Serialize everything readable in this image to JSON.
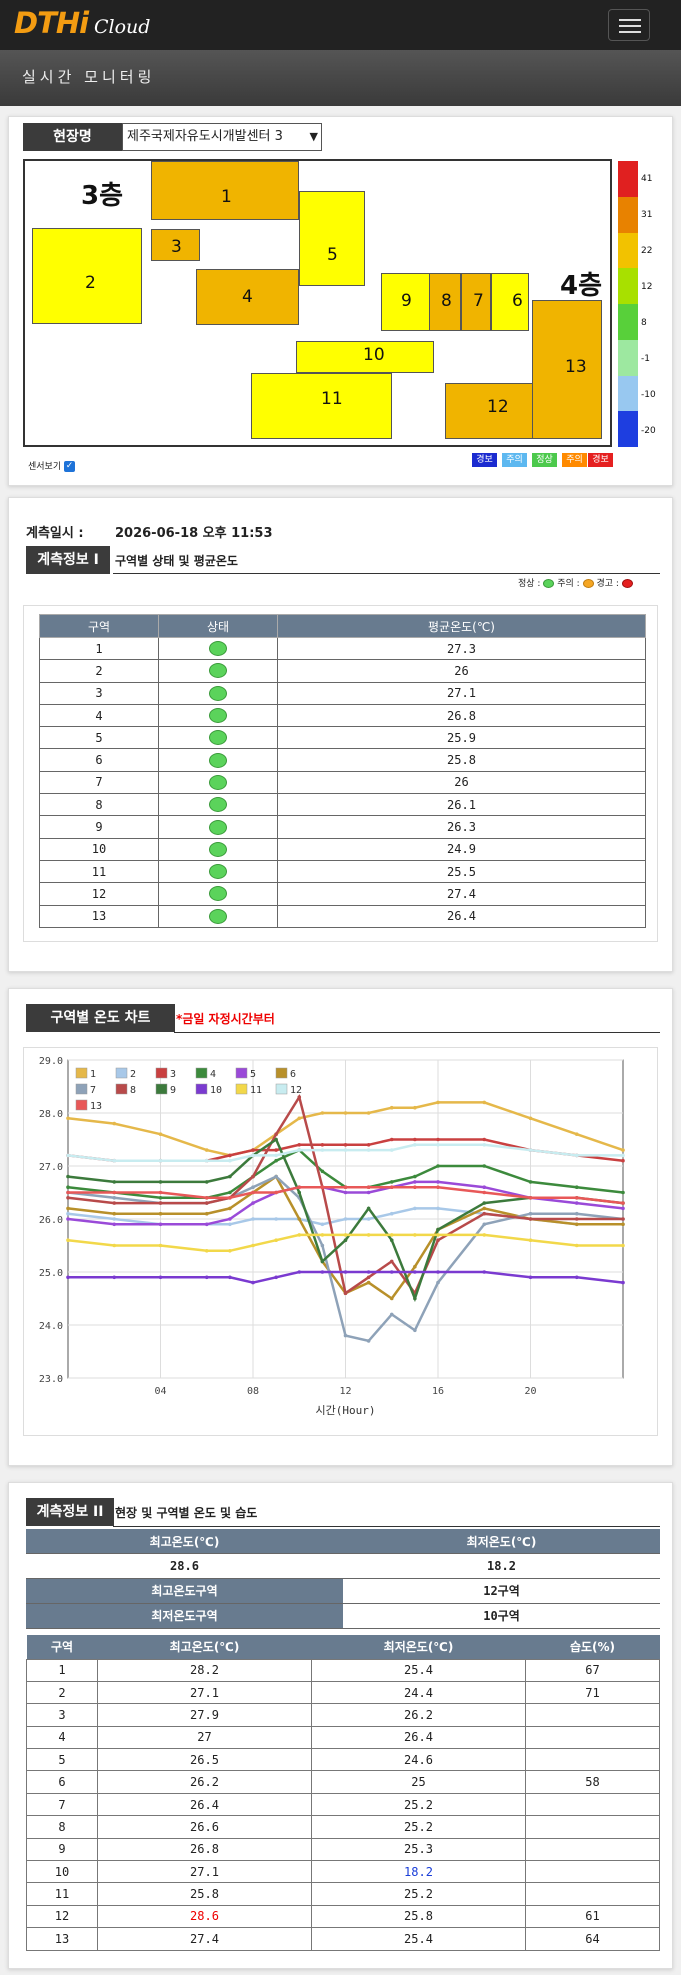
{
  "app": {
    "logo_main": "DTHi",
    "logo_sub": "Cloud"
  },
  "header": {
    "title": "실시간 모니터링"
  },
  "site": {
    "label": "현장명",
    "selected": "제주국제자유도시개발센터 3",
    "floor_3": "3층",
    "floor_4": "4층",
    "zones": [
      "1",
      "2",
      "3",
      "4",
      "5",
      "6",
      "7",
      "8",
      "9",
      "10",
      "11",
      "12",
      "13"
    ],
    "sensor_toggle": "센서보기",
    "scale_labels": [
      "41",
      "31",
      "22",
      "12",
      "8",
      "-1",
      "-10",
      "-20"
    ],
    "scale_colors": [
      "#e02020",
      "#e88200",
      "#f2c200",
      "#a8e000",
      "#58d03a",
      "#9de8a0",
      "#98c8f0",
      "#1e3ee0"
    ],
    "legend": [
      {
        "text": "경보",
        "color": "#1b2bd0"
      },
      {
        "text": "주의",
        "color": "#5db8f0"
      },
      {
        "text": "정상",
        "color": "#4cc94c"
      },
      {
        "text": "주의",
        "color": "#ff8a00"
      },
      {
        "text": "경보",
        "color": "#e52020"
      }
    ]
  },
  "measure": {
    "label": "계측일시 :",
    "datetime": "2026-06-18 오후 11:53"
  },
  "info1": {
    "tab": "계측정보 I",
    "subtitle": "구역별 상태 및 평균온도",
    "legend_normal": "정상 :",
    "legend_caution": "주의 :",
    "legend_warn": "경고 :",
    "col_zone": "구역",
    "col_status": "상태",
    "col_avg": "평균온도(℃)",
    "rows": [
      {
        "zone": "1",
        "avg": "27.3"
      },
      {
        "zone": "2",
        "avg": "26"
      },
      {
        "zone": "3",
        "avg": "27.1"
      },
      {
        "zone": "4",
        "avg": "26.8"
      },
      {
        "zone": "5",
        "avg": "25.9"
      },
      {
        "zone": "6",
        "avg": "25.8"
      },
      {
        "zone": "7",
        "avg": "26"
      },
      {
        "zone": "8",
        "avg": "26.1"
      },
      {
        "zone": "9",
        "avg": "26.3"
      },
      {
        "zone": "10",
        "avg": "24.9"
      },
      {
        "zone": "11",
        "avg": "25.5"
      },
      {
        "zone": "12",
        "avg": "27.4"
      },
      {
        "zone": "13",
        "avg": "26.4"
      }
    ]
  },
  "chart_section": {
    "tab": "구역별 온도 차트",
    "note": "*금일 자정시간부터"
  },
  "chart_data": {
    "type": "line",
    "xlabel": "시간(Hour)",
    "ylabel": "",
    "title": "",
    "xlim": [
      0,
      24
    ],
    "ylim": [
      23.0,
      29.0
    ],
    "x_ticks": [
      4,
      8,
      12,
      16,
      20
    ],
    "x_tick_labels": [
      "04",
      "08",
      "12",
      "16",
      "20"
    ],
    "y_ticks": [
      23.0,
      24.0,
      25.0,
      26.0,
      27.0,
      28.0,
      29.0
    ],
    "y_tick_labels": [
      "23.0",
      "24.0",
      "25.0",
      "26.0",
      "27.0",
      "28.0",
      "29.0"
    ],
    "grid": true,
    "legend_position": "top-left",
    "x": [
      0,
      2,
      4,
      6,
      7,
      8,
      9,
      10,
      11,
      12,
      13,
      14,
      15,
      16,
      18,
      20,
      22,
      24
    ],
    "series": [
      {
        "name": "1",
        "color": "#e5b84a",
        "values": [
          27.9,
          27.8,
          27.6,
          27.3,
          27.2,
          27.3,
          27.6,
          27.9,
          28.0,
          28.0,
          28.0,
          28.1,
          28.1,
          28.2,
          28.2,
          27.9,
          27.6,
          27.3
        ]
      },
      {
        "name": "2",
        "color": "#a8c8e8",
        "values": [
          26.1,
          26.0,
          25.9,
          25.9,
          25.9,
          26.0,
          26.0,
          26.0,
          25.9,
          26.0,
          26.0,
          26.1,
          26.2,
          26.2,
          26.1,
          26.0,
          25.9,
          25.9
        ]
      },
      {
        "name": "3",
        "color": "#c94040",
        "values": [
          27.2,
          27.1,
          27.1,
          27.1,
          27.2,
          27.3,
          27.3,
          27.4,
          27.4,
          27.4,
          27.4,
          27.5,
          27.5,
          27.5,
          27.5,
          27.3,
          27.2,
          27.1
        ]
      },
      {
        "name": "4",
        "color": "#3c8a3c",
        "values": [
          26.6,
          26.5,
          26.4,
          26.4,
          26.5,
          26.8,
          27.1,
          27.3,
          26.9,
          26.6,
          26.6,
          26.7,
          26.8,
          27.0,
          27.0,
          26.7,
          26.6,
          26.5
        ]
      },
      {
        "name": "5",
        "color": "#9a4ad8",
        "values": [
          26.0,
          25.9,
          25.9,
          25.9,
          26.0,
          26.3,
          26.5,
          26.6,
          26.6,
          26.5,
          26.5,
          26.6,
          26.7,
          26.7,
          26.6,
          26.4,
          26.3,
          26.2
        ]
      },
      {
        "name": "6",
        "color": "#b8902a",
        "values": [
          26.2,
          26.1,
          26.1,
          26.1,
          26.2,
          26.5,
          26.8,
          26.0,
          25.2,
          24.6,
          24.8,
          24.5,
          25.1,
          25.8,
          26.2,
          26.0,
          25.9,
          25.9
        ]
      },
      {
        "name": "7",
        "color": "#8ea2b8",
        "values": [
          26.5,
          26.4,
          26.3,
          26.3,
          26.4,
          26.6,
          26.8,
          26.4,
          25.5,
          23.8,
          23.7,
          24.2,
          23.9,
          24.8,
          25.9,
          26.1,
          26.1,
          26.0
        ]
      },
      {
        "name": "8",
        "color": "#b84a4a",
        "values": [
          26.4,
          26.3,
          26.3,
          26.3,
          26.4,
          26.8,
          27.6,
          28.3,
          26.6,
          24.6,
          24.9,
          25.2,
          24.6,
          25.6,
          26.1,
          26.0,
          26.0,
          26.0
        ]
      },
      {
        "name": "9",
        "color": "#3c7a3c",
        "values": [
          26.8,
          26.7,
          26.7,
          26.7,
          26.8,
          27.2,
          27.5,
          26.5,
          25.2,
          25.6,
          26.2,
          25.6,
          24.5,
          25.8,
          26.3,
          26.4,
          26.4,
          26.3
        ]
      },
      {
        "name": "10",
        "color": "#7a3ad0",
        "values": [
          24.9,
          24.9,
          24.9,
          24.9,
          24.9,
          24.8,
          24.9,
          25.0,
          25.0,
          25.0,
          25.0,
          25.0,
          25.0,
          25.0,
          25.0,
          24.9,
          24.9,
          24.8
        ]
      },
      {
        "name": "11",
        "color": "#f2d84a",
        "values": [
          25.6,
          25.5,
          25.5,
          25.4,
          25.4,
          25.5,
          25.6,
          25.7,
          25.7,
          25.7,
          25.7,
          25.7,
          25.7,
          25.7,
          25.7,
          25.6,
          25.5,
          25.5
        ]
      },
      {
        "name": "12",
        "color": "#c8ecf0",
        "values": [
          27.2,
          27.1,
          27.1,
          27.1,
          27.1,
          27.2,
          27.2,
          27.3,
          27.3,
          27.3,
          27.3,
          27.3,
          27.4,
          27.4,
          27.4,
          27.3,
          27.2,
          27.2
        ]
      },
      {
        "name": "13",
        "color": "#e85858",
        "values": [
          26.5,
          26.5,
          26.5,
          26.4,
          26.4,
          26.5,
          26.5,
          26.6,
          26.6,
          26.6,
          26.6,
          26.6,
          26.6,
          26.6,
          26.5,
          26.4,
          26.4,
          26.3
        ]
      }
    ]
  },
  "info2": {
    "tab": "계측정보 II",
    "subtitle": "현장 및 구역별 온도 및 습도",
    "max_label": "최고온도(℃)",
    "min_label": "최저온도(℃)",
    "max_value": "28.6",
    "min_value": "18.2",
    "max_zone_label": "최고온도구역",
    "max_zone_value": "12구역",
    "min_zone_label": "최저온도구역",
    "min_zone_value": "10구역",
    "col_zone": "구역",
    "col_max": "최고온도(℃)",
    "col_min": "최저온도(℃)",
    "col_hum": "습도(%)",
    "rows": [
      {
        "zone": "1",
        "max": "28.2",
        "min": "25.4",
        "hum": "67"
      },
      {
        "zone": "2",
        "max": "27.1",
        "min": "24.4",
        "hum": "71"
      },
      {
        "zone": "3",
        "max": "27.9",
        "min": "26.2",
        "hum": ""
      },
      {
        "zone": "4",
        "max": "27",
        "min": "26.4",
        "hum": ""
      },
      {
        "zone": "5",
        "max": "26.5",
        "min": "24.6",
        "hum": ""
      },
      {
        "zone": "6",
        "max": "26.2",
        "min": "25",
        "hum": "58"
      },
      {
        "zone": "7",
        "max": "26.4",
        "min": "25.2",
        "hum": ""
      },
      {
        "zone": "8",
        "max": "26.6",
        "min": "25.2",
        "hum": ""
      },
      {
        "zone": "9",
        "max": "26.8",
        "min": "25.3",
        "hum": ""
      },
      {
        "zone": "10",
        "max": "27.1",
        "min": "18.2",
        "hum": ""
      },
      {
        "zone": "11",
        "max": "25.8",
        "min": "25.2",
        "hum": ""
      },
      {
        "zone": "12",
        "max": "28.6",
        "min": "25.8",
        "hum": "61"
      },
      {
        "zone": "13",
        "max": "27.4",
        "min": "25.4",
        "hum": "64"
      }
    ]
  }
}
